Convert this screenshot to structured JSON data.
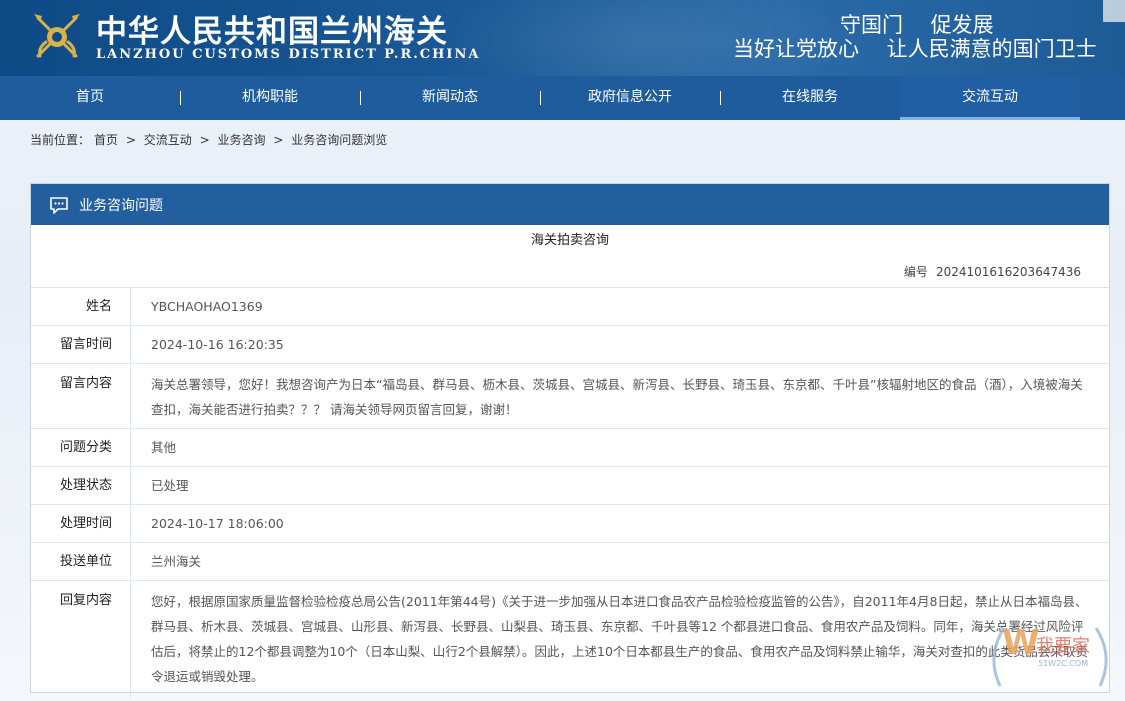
{
  "header": {
    "title_cn": "中华人民共和国兰州海关",
    "title_en": "LANZHOU CUSTOMS DISTRICT P.R.CHINA",
    "slogan_line1": "守国门　 促发展",
    "slogan_line2": "当好让党放心　 让人民满意的国门卫士"
  },
  "nav": {
    "items": [
      {
        "label": "首页"
      },
      {
        "label": "机构职能"
      },
      {
        "label": "新闻动态"
      },
      {
        "label": "政府信息公开"
      },
      {
        "label": "在线服务"
      },
      {
        "label": "交流互动"
      }
    ],
    "active_index": 5
  },
  "breadcrumb": {
    "prefix": "当前位置：",
    "items": [
      "首页",
      ">",
      "交流互动",
      ">",
      "业务咨询",
      ">",
      "业务咨询问题浏览"
    ]
  },
  "panel": {
    "heading": "业务咨询问题",
    "question_title": "海关拍卖咨询",
    "number_label": "编号",
    "number_value": "2024101616203647436",
    "fields": {
      "name": {
        "label": "姓名",
        "value": "YBCHAOHAO1369"
      },
      "time": {
        "label": "留言时间",
        "value": "2024-10-16 16:20:35"
      },
      "content": {
        "label": "留言内容",
        "value": "海关总署领导，您好！我想咨询产为日本“福岛县、群马县、枥木县、茨城县、宫城县、新泻县、长野县、琦玉县、东京都、千叶县”核辐射地区的食品（酒），入境被海关查扣，海关能否进行拍卖？？？ 请海关领导网页留言回复，谢谢！"
      },
      "category": {
        "label": "问题分类",
        "value": "其他"
      },
      "status": {
        "label": "处理状态",
        "value": "已处理"
      },
      "handle_time": {
        "label": "处理时间",
        "value": "2024-10-17 18:06:00"
      },
      "unit": {
        "label": "投送单位",
        "value": "兰州海关"
      },
      "reply": {
        "label": "回复内容",
        "value": "您好，根据原国家质量监督检验检疫总局公告(2011年第44号)《关于进一步加强从日本进口食品农产品检验检疫监管的公告》，自2011年4月8日起，禁止从日本福岛县、群马县、析木县、茨城县、宫城县、山形县、新泻县、长野县、山梨县、琦玉县、东京都、千叶县等12 个都县进口食品、食用农产品及饲料。同年，海关总署经过风险评估后，将禁止的12个都县调整为10个（日本山梨、山行2个县解禁）。因此，上述10个日本都县生产的食品、食用农产品及饲料禁止输华，海关对查扣的此类货品会采取责令退运或销毁处理。"
      }
    }
  },
  "watermark": {
    "brand": "我要家",
    "domain": "51W2C.COM"
  },
  "colors": {
    "header_blue": "#0d4a86",
    "nav_blue": "#1e5c9e",
    "panel_head": "#235f9f",
    "emblem_gold": "#d8b24a"
  }
}
